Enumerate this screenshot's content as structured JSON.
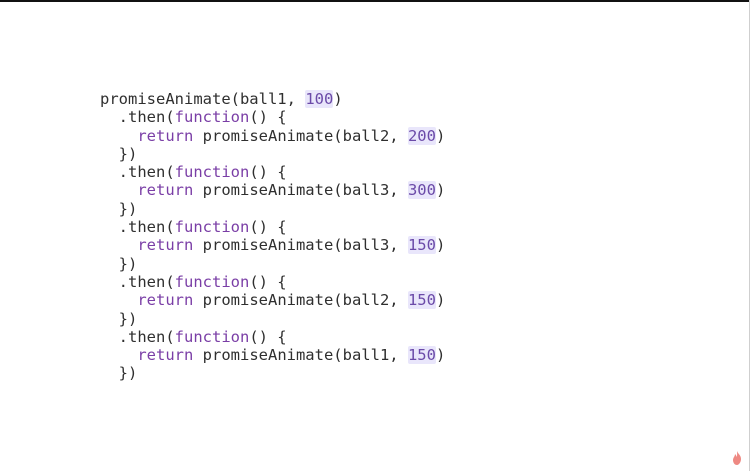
{
  "code": {
    "lines": [
      {
        "tokens": [
          {
            "t": "promiseAnimate(ball1, ",
            "k": "text"
          },
          {
            "t": "100",
            "k": "number"
          },
          {
            "t": ")",
            "k": "text"
          }
        ]
      },
      {
        "tokens": [
          {
            "t": "  .then(",
            "k": "text"
          },
          {
            "t": "function",
            "k": "keyword"
          },
          {
            "t": "() {",
            "k": "text"
          }
        ]
      },
      {
        "tokens": [
          {
            "t": "    ",
            "k": "text"
          },
          {
            "t": "return",
            "k": "keyword"
          },
          {
            "t": " promiseAnimate(ball2, ",
            "k": "text"
          },
          {
            "t": "200",
            "k": "number"
          },
          {
            "t": ")",
            "k": "text"
          }
        ]
      },
      {
        "tokens": [
          {
            "t": "  })",
            "k": "text"
          }
        ]
      },
      {
        "tokens": [
          {
            "t": "  .then(",
            "k": "text"
          },
          {
            "t": "function",
            "k": "keyword"
          },
          {
            "t": "() {",
            "k": "text"
          }
        ]
      },
      {
        "tokens": [
          {
            "t": "    ",
            "k": "text"
          },
          {
            "t": "return",
            "k": "keyword"
          },
          {
            "t": " promiseAnimate(ball3, ",
            "k": "text"
          },
          {
            "t": "300",
            "k": "number"
          },
          {
            "t": ")",
            "k": "text"
          }
        ]
      },
      {
        "tokens": [
          {
            "t": "  })",
            "k": "text"
          }
        ]
      },
      {
        "tokens": [
          {
            "t": "  .then(",
            "k": "text"
          },
          {
            "t": "function",
            "k": "keyword"
          },
          {
            "t": "() {",
            "k": "text"
          }
        ]
      },
      {
        "tokens": [
          {
            "t": "    ",
            "k": "text"
          },
          {
            "t": "return",
            "k": "keyword"
          },
          {
            "t": " promiseAnimate(ball3, ",
            "k": "text"
          },
          {
            "t": "150",
            "k": "number"
          },
          {
            "t": ")",
            "k": "text"
          }
        ]
      },
      {
        "tokens": [
          {
            "t": "  })",
            "k": "text"
          }
        ]
      },
      {
        "tokens": [
          {
            "t": "  .then(",
            "k": "text"
          },
          {
            "t": "function",
            "k": "keyword"
          },
          {
            "t": "() {",
            "k": "text"
          }
        ]
      },
      {
        "tokens": [
          {
            "t": "    ",
            "k": "text"
          },
          {
            "t": "return",
            "k": "keyword"
          },
          {
            "t": " promiseAnimate(ball2, ",
            "k": "text"
          },
          {
            "t": "150",
            "k": "number"
          },
          {
            "t": ")",
            "k": "text"
          }
        ]
      },
      {
        "tokens": [
          {
            "t": "  })",
            "k": "text"
          }
        ]
      },
      {
        "tokens": [
          {
            "t": "  .then(",
            "k": "text"
          },
          {
            "t": "function",
            "k": "keyword"
          },
          {
            "t": "() {",
            "k": "text"
          }
        ]
      },
      {
        "tokens": [
          {
            "t": "    ",
            "k": "text"
          },
          {
            "t": "return",
            "k": "keyword"
          },
          {
            "t": " promiseAnimate(ball1, ",
            "k": "text"
          },
          {
            "t": "150",
            "k": "number"
          },
          {
            "t": ")",
            "k": "text"
          }
        ]
      },
      {
        "tokens": [
          {
            "t": "  })",
            "k": "text"
          }
        ]
      }
    ]
  },
  "colors": {
    "keyword": "#7a3ea6",
    "number_text": "#6b4aa8",
    "number_highlight": "#e9e6fb",
    "text": "#2f2f2f",
    "background": "#ffffff",
    "logo": "#e8625a"
  },
  "corner_logo": {
    "icon": "flame-icon"
  }
}
